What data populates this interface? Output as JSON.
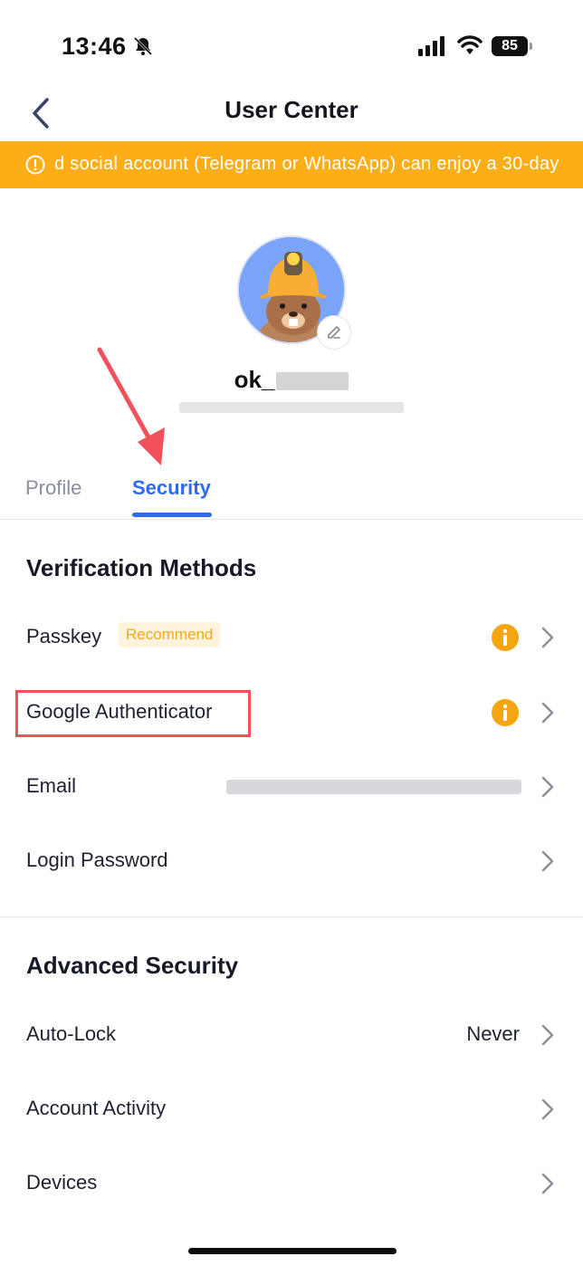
{
  "status": {
    "time": "13:46",
    "battery": "85"
  },
  "nav": {
    "title": "User Center"
  },
  "banner": {
    "text": "d social account (Telegram or WhatsApp) can enjoy a 30-day"
  },
  "profile": {
    "username_visible": "ok_"
  },
  "tabs": [
    {
      "label": "Profile",
      "active": false
    },
    {
      "label": "Security",
      "active": true
    }
  ],
  "verification": {
    "title": "Verification Methods",
    "items": [
      {
        "label": "Passkey",
        "tag": "Recommend"
      },
      {
        "label": "Google Authenticator"
      },
      {
        "label": "Email"
      },
      {
        "label": "Login Password"
      }
    ]
  },
  "advanced": {
    "title": "Advanced Security",
    "items": [
      {
        "label": "Auto-Lock",
        "value": "Never"
      },
      {
        "label": "Account Activity"
      },
      {
        "label": "Devices"
      }
    ]
  },
  "colors": {
    "accent": "#2d6bf0",
    "warning": "#fdae17",
    "highlight": "#f0515a"
  }
}
